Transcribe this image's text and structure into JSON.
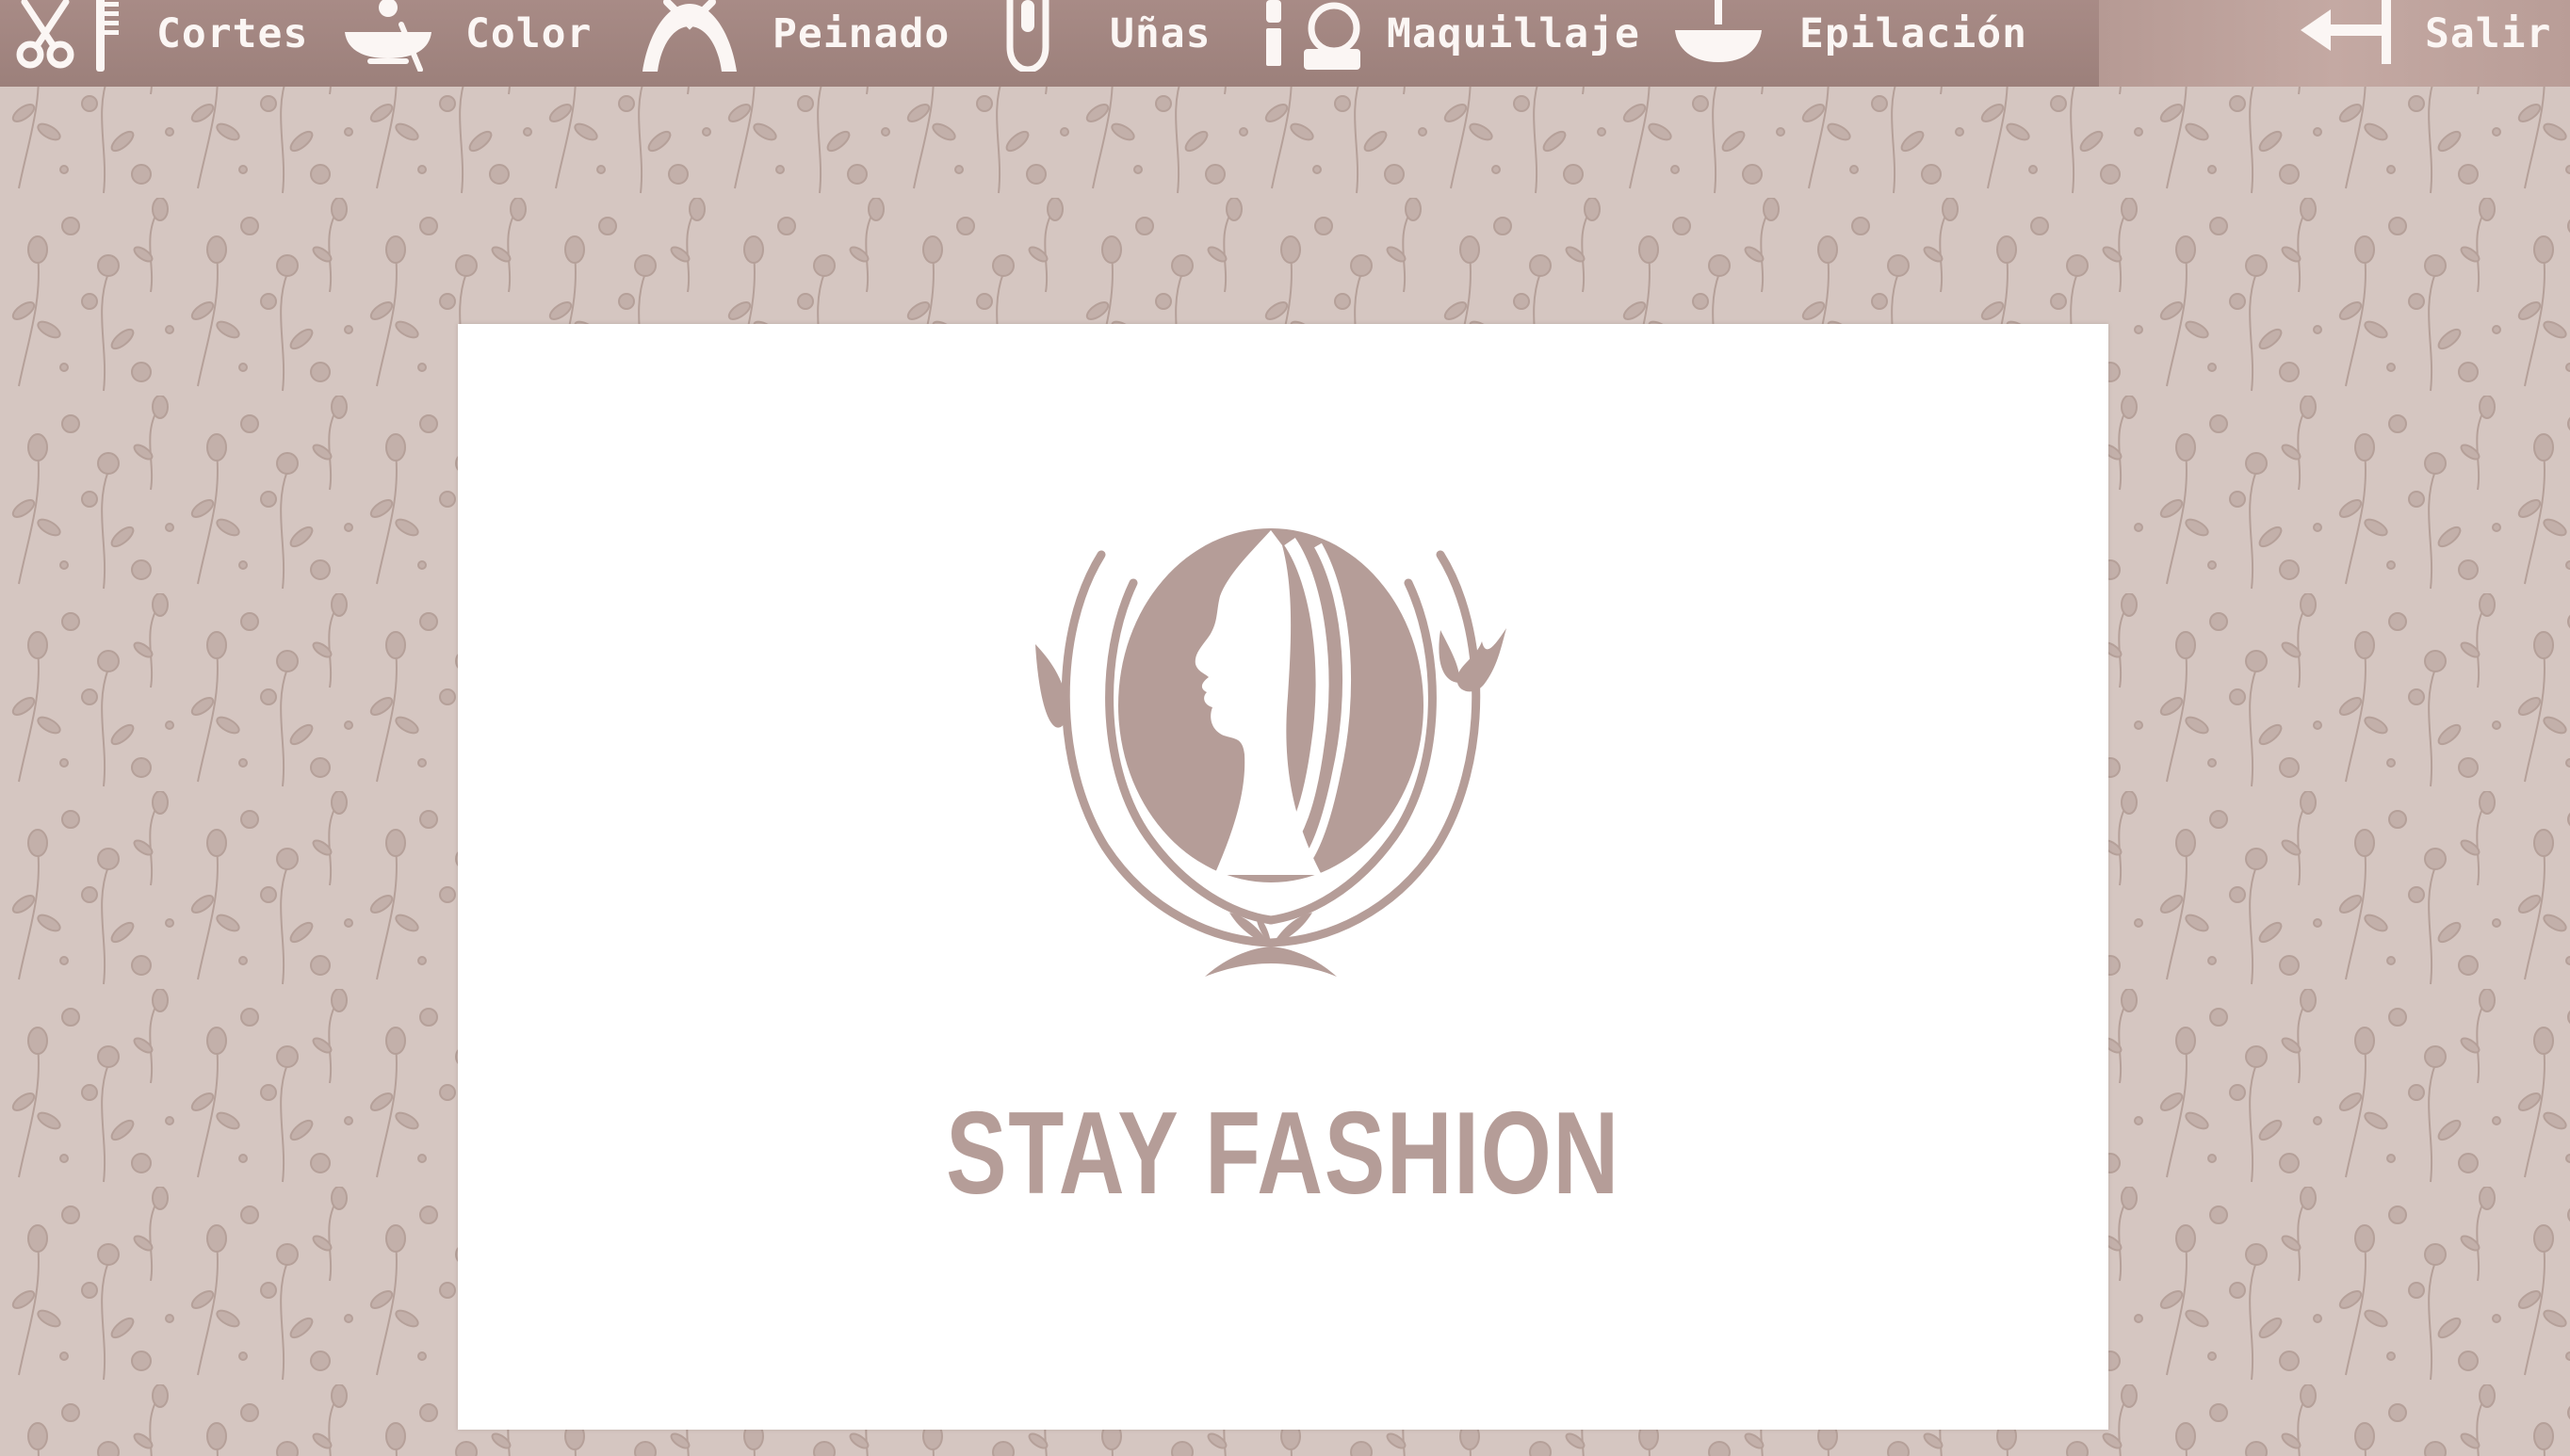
{
  "nav": {
    "items": [
      {
        "label": "Cortes",
        "icon": "scissors-comb-icon"
      },
      {
        "label": "Color",
        "icon": "dye-bowl-icon"
      },
      {
        "label": "Peinado",
        "icon": "hairstyle-icon"
      },
      {
        "label": "Uñas",
        "icon": "nail-icon"
      },
      {
        "label": "Maquillaje",
        "icon": "makeup-icon"
      },
      {
        "label": "Epilación",
        "icon": "wax-bowl-icon"
      }
    ],
    "exit": {
      "label": "Salir",
      "icon": "exit-arrow-icon"
    }
  },
  "brand": {
    "name": "STAY FASHION",
    "logo": "woman-profile-leaf-wreath-logo"
  },
  "colors": {
    "topbar": "#a88b86",
    "background": "#d3c3bd",
    "pattern": "#bda9a3",
    "brand": "#b59d98",
    "nav_text": "#fbf6f4"
  }
}
